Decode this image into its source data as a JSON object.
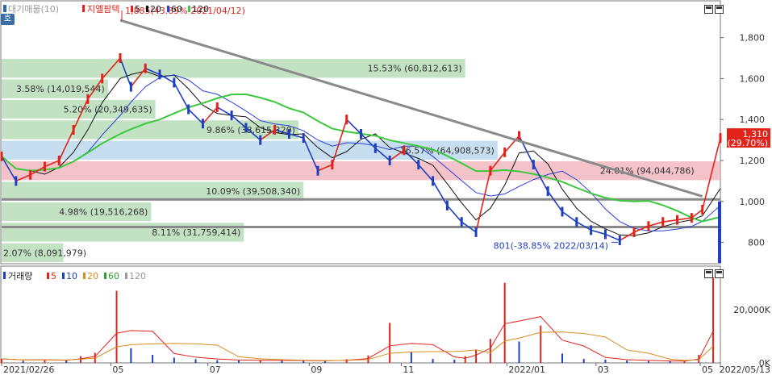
{
  "legend_price": {
    "tab": "대기매물(10)",
    "name": "지엘팜텍",
    "ma": [
      "5",
      "20",
      "60",
      "120"
    ]
  },
  "legend_volume": {
    "name": "거래량",
    "ma": [
      "5",
      "10",
      "20",
      "60",
      "120"
    ]
  },
  "side_button": "호",
  "annotations": {
    "high": "1,885(43.89% 2021/04/12)",
    "low": "801(-38.85% 2022/03/14)",
    "last_price": "1,310",
    "last_change": "(29.70%)"
  },
  "colors": {
    "up": "#e2231a",
    "down": "#1f3fbf",
    "ma5": "#111111",
    "ma20": "#2b3fd6",
    "ma60": "#3cc83c",
    "ma120": "#9a9a9a",
    "supply_band": "#b7ddb8",
    "supply_current": "#f2b9c0",
    "supply_blue": "#bcd8ec"
  },
  "chart_data": [
    {
      "type": "candlestick",
      "panel": "price",
      "x_ticks": [
        "2021/02/26",
        "05",
        "07",
        "09",
        "11",
        "2022/01",
        "03",
        "05",
        "2022/05/13"
      ],
      "y_ticks": [
        800,
        1000,
        1200,
        1400,
        1600,
        1800
      ],
      "ylim": [
        700,
        1960
      ],
      "trendline": [
        [
          0.165,
          1885
        ],
        [
          0.975,
          1025
        ]
      ],
      "horizontal_lines": [
        1010,
        875
      ],
      "supply_zones": [
        {
          "label": "15.53% (60,812,613)",
          "low": 1600,
          "high": 1700,
          "width": 0.645,
          "kind": "green"
        },
        {
          "label": "3.58% (14,019,544)",
          "low": 1500,
          "high": 1600,
          "width": 0.148,
          "kind": "green"
        },
        {
          "label": "5.20% (20,349,635)",
          "low": 1400,
          "high": 1500,
          "width": 0.214,
          "kind": "green"
        },
        {
          "label": "9.86% (38,615,320)",
          "low": 1300,
          "high": 1400,
          "width": 0.413,
          "kind": "green"
        },
        {
          "label": "16.57% (64,908,573)",
          "low": 1200,
          "high": 1300,
          "width": 0.69,
          "kind": "blue"
        },
        {
          "label": "24.01% (94,044,786)",
          "low": 1100,
          "high": 1200,
          "width": 1.0,
          "kind": "pink"
        },
        {
          "label": "10.09% (39,508,340)",
          "low": 1000,
          "high": 1100,
          "width": 0.42,
          "kind": "green"
        },
        {
          "label": "4.98% (19,516,268)",
          "low": 900,
          "high": 1000,
          "width": 0.208,
          "kind": "green"
        },
        {
          "label": "8.11% (31,759,414)",
          "low": 800,
          "high": 900,
          "width": 0.337,
          "kind": "green"
        },
        {
          "label": "2.07% (8,091,979)",
          "low": 700,
          "high": 800,
          "width": 0.086,
          "kind": "green"
        }
      ],
      "series": [
        {
          "name": "지엘팜텍",
          "x": [
            0.0,
            0.02,
            0.04,
            0.06,
            0.08,
            0.1,
            0.12,
            0.14,
            0.165,
            0.18,
            0.2,
            0.22,
            0.24,
            0.26,
            0.28,
            0.3,
            0.32,
            0.34,
            0.36,
            0.38,
            0.4,
            0.42,
            0.44,
            0.46,
            0.48,
            0.5,
            0.52,
            0.54,
            0.56,
            0.58,
            0.6,
            0.62,
            0.64,
            0.66,
            0.68,
            0.7,
            0.72,
            0.74,
            0.76,
            0.78,
            0.8,
            0.82,
            0.84,
            0.86,
            0.88,
            0.9,
            0.92,
            0.94,
            0.96,
            0.975,
            1.0
          ],
          "close": [
            1220,
            1100,
            1130,
            1170,
            1200,
            1350,
            1500,
            1600,
            1700,
            1560,
            1650,
            1620,
            1580,
            1450,
            1380,
            1460,
            1420,
            1360,
            1300,
            1350,
            1330,
            1310,
            1150,
            1180,
            1400,
            1330,
            1260,
            1200,
            1250,
            1180,
            1100,
            980,
            900,
            850,
            1150,
            1240,
            1320,
            1180,
            1050,
            950,
            900,
            860,
            840,
            810,
            850,
            880,
            900,
            910,
            920,
            960,
            1310
          ]
        }
      ]
    },
    {
      "type": "bar",
      "panel": "volume",
      "y_ticks": [
        "0K",
        "20,000K"
      ],
      "ylim": [
        0,
        32000
      ],
      "x": [
        0.0,
        0.03,
        0.06,
        0.09,
        0.11,
        0.13,
        0.16,
        0.18,
        0.21,
        0.24,
        0.27,
        0.3,
        0.33,
        0.36,
        0.39,
        0.42,
        0.45,
        0.48,
        0.51,
        0.54,
        0.57,
        0.6,
        0.63,
        0.645,
        0.66,
        0.68,
        0.7,
        0.72,
        0.75,
        0.78,
        0.81,
        0.84,
        0.87,
        0.9,
        0.93,
        0.95,
        0.97,
        0.99
      ],
      "values": [
        1500,
        800,
        1200,
        900,
        2500,
        3800,
        27000,
        5500,
        3000,
        2000,
        1400,
        1000,
        900,
        1000,
        900,
        800,
        700,
        1400,
        2800,
        15000,
        4000,
        1500,
        1200,
        2500,
        5000,
        9000,
        30000,
        8000,
        14000,
        3500,
        1500,
        1200,
        900,
        700,
        600,
        700,
        3000,
        32000
      ]
    }
  ],
  "legend_ma_colors": [
    "#e2231a",
    "#111111",
    "#2b3fd6",
    "#3cc83c",
    "#9a9a9a"
  ]
}
